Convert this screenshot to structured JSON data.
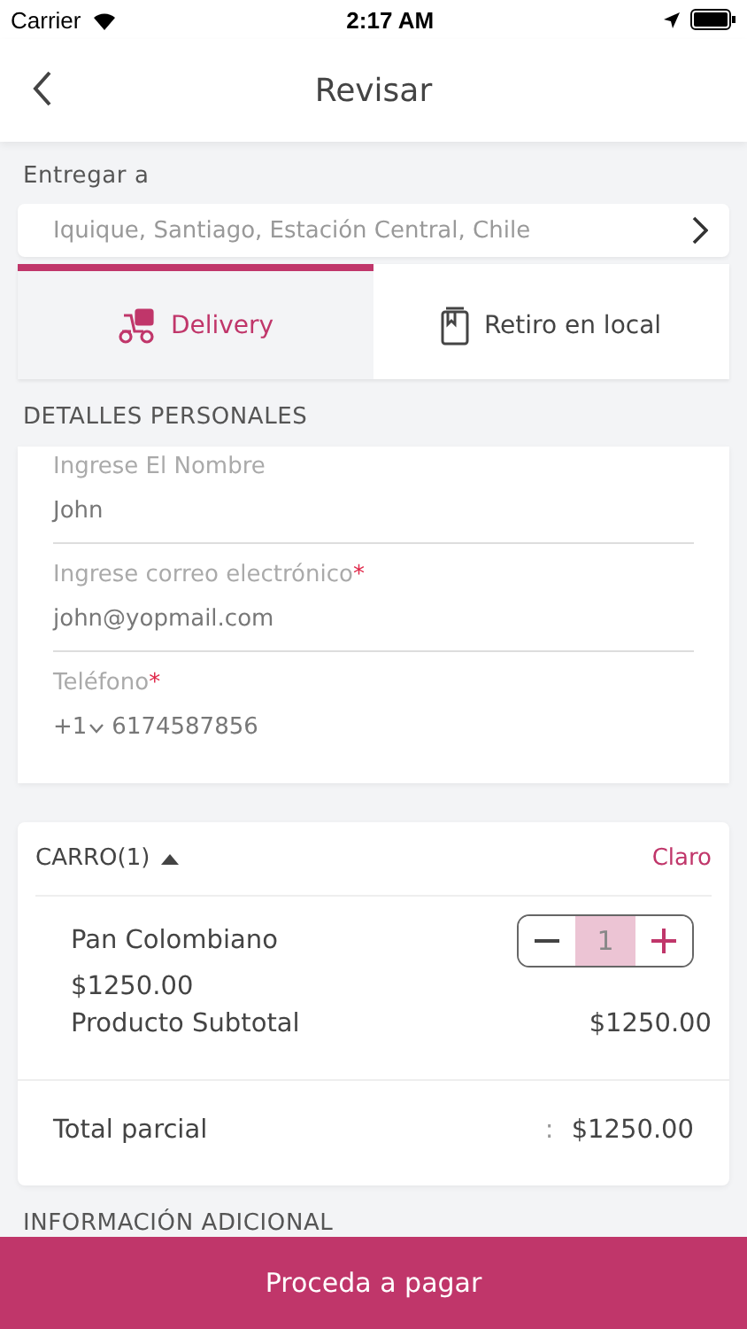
{
  "status_bar": {
    "carrier": "Carrier",
    "time": "2:17 AM"
  },
  "nav": {
    "title": "Revisar"
  },
  "delivery_to": {
    "label": "Entregar a",
    "address": "Iquique, Santiago, Estación Central, Chile"
  },
  "tabs": [
    {
      "label": "Delivery",
      "kind": "scooter",
      "selected": true
    },
    {
      "label": "Retiro en local",
      "kind": "bag",
      "selected": false
    }
  ],
  "personal": {
    "heading": "DETALLES PERSONALES",
    "fields": [
      {
        "label": "Ingrese El Nombre",
        "value": "John"
      },
      {
        "label": "Ingrese correo electrónico",
        "required_mark": "*",
        "value": "john@yopmail.com"
      },
      {
        "label": "Teléfono",
        "required_mark": "*",
        "prefix": "+1",
        "value": "6174587856"
      }
    ]
  },
  "cart": {
    "title": "CARRO(1)",
    "expanded": true,
    "clear": "Claro",
    "items": [
      {
        "name": "Pan Colombiano",
        "price": "$1250.00",
        "quantity": "1",
        "subtotal_label": "Producto Subtotal",
        "subtotal": "$1250.00"
      }
    ],
    "total_label": "Total parcial",
    "total_sep": ":",
    "total": "$1250.00"
  },
  "additional": {
    "heading": "INFORMACIÓN ADICIONAL"
  },
  "pay_button": "Proceda a pagar"
}
